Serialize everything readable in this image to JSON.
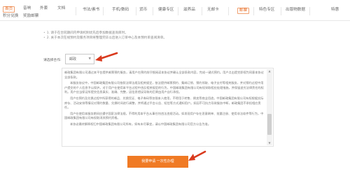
{
  "nav": {
    "row1": [
      {
        "label": "首页",
        "active": true
      },
      {
        "label": "音响"
      },
      {
        "label": "外套"
      },
      {
        "label": "文档"
      },
      {
        "label": "书法/素书"
      },
      {
        "label": "手机/数码"
      },
      {
        "label": "货币"
      },
      {
        "label": "健康专区"
      },
      {
        "label": "滋养品"
      },
      {
        "label": "无邮卡"
      },
      {
        "label": "邮票",
        "orange": true
      },
      {
        "label": "特色专区"
      },
      {
        "label": "出版物数据"
      },
      {
        "label": "特惠"
      }
    ],
    "row2": [
      {
        "label": "积分兑换"
      },
      {
        "label": "奖励邮票"
      }
    ]
  },
  "notes": [
    "1. 请于在合同期间内申请机制优先后参加数据查询库时。",
    "2. 关于本次在线预约及服务项目将整理完毕以后进入订单中心及本预约单查阅清单。"
  ],
  "select": {
    "label": "请选择合作:",
    "value": "邮政"
  },
  "agreement": {
    "paragraphs": [
      "邮政集团有限公司通过本平台提供邮票预约服务，请用户在预约前仔细阅读本协议并确认全部条款内容，完成一键式预约。用户点击提交即视为同意本协议全部条款。",
      "本服务协议中，中国邮政集团有限公司依照法律法规及相关规定，依法提供邮票预约、集邮订销、预约领取、电子支付等相关服务，并对预约过程中用户提交的个人信息予以保护。对于用户在使用本平台过程中违反相关规定的行为，中国邮政集团有限公司有权采取相应处理措施，并保留追究法律责任的权利。用户应当保证所提交信息真实、准确、完整，因信息错误导致的后果由用户自行承担。",
      "用户在预约及兑换过程中所获得的邮品、兑换凭证、电子券码等仅限本人使用，不得用于转售、倒卖等商业用途。中国邮政集团有限公司有权根据实际库存、活动安排等情况对预约数量、兑换时间进行调整，并将通过平台公告、短信等方式通知用户。如因不可抗力导致服务中断，邮政集团不承担相应责任。",
      "用户在使用本服务期间应遵守国家法律法规，不得利用本平台从事任何违法违规活动。如发现用户存在恶意刷单、批量注册、使用非法软件等行为，中国邮政集团有限公司有权取消其预约资格。",
      "本协议最终解释权归中国邮政集团有限公司所有，如有未尽事宜，请以中国邮政集团有限公司官方公告为准。"
    ]
  },
  "submit_label": "我要申请 一次性办理",
  "colors": {
    "accent": "#f07a24",
    "arrow": "#d93a1e"
  }
}
